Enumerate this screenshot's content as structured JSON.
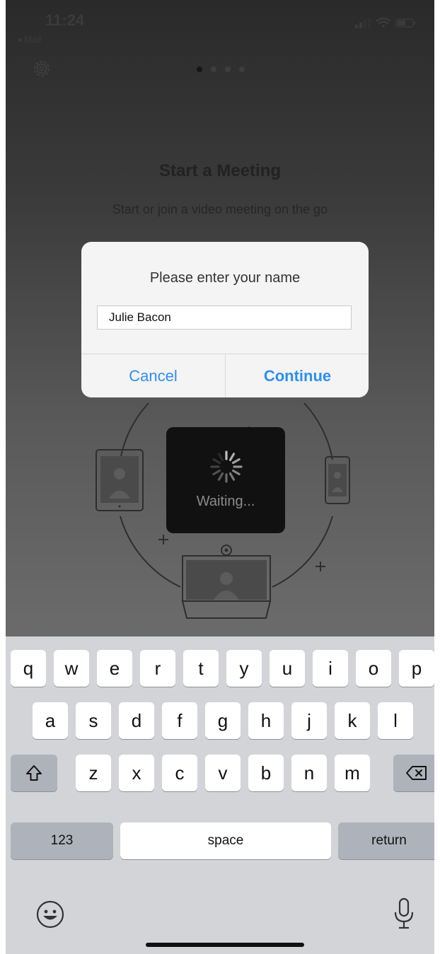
{
  "status_bar": {
    "time": "11:24",
    "back_label": "◂ Mail"
  },
  "header": {
    "title": "Start a Meeting",
    "subtitle": "Start or join a video meeting on the go"
  },
  "dialog": {
    "title": "Please enter your name",
    "input_value": "Julie Bacon",
    "cancel_label": "Cancel",
    "continue_label": "Continue"
  },
  "waiting": {
    "label": "Waiting..."
  },
  "keyboard": {
    "row1": [
      "q",
      "w",
      "e",
      "r",
      "t",
      "y",
      "u",
      "i",
      "o",
      "p"
    ],
    "row2": [
      "a",
      "s",
      "d",
      "f",
      "g",
      "h",
      "j",
      "k",
      "l"
    ],
    "row3": [
      "z",
      "x",
      "c",
      "v",
      "b",
      "n",
      "m"
    ],
    "numbers_label": "123",
    "space_label": "space",
    "return_label": "return"
  },
  "colors": {
    "accent": "#2e8ff0",
    "overlay": "#5a5a5a",
    "keyboard_bg": "#d2d4d8"
  }
}
